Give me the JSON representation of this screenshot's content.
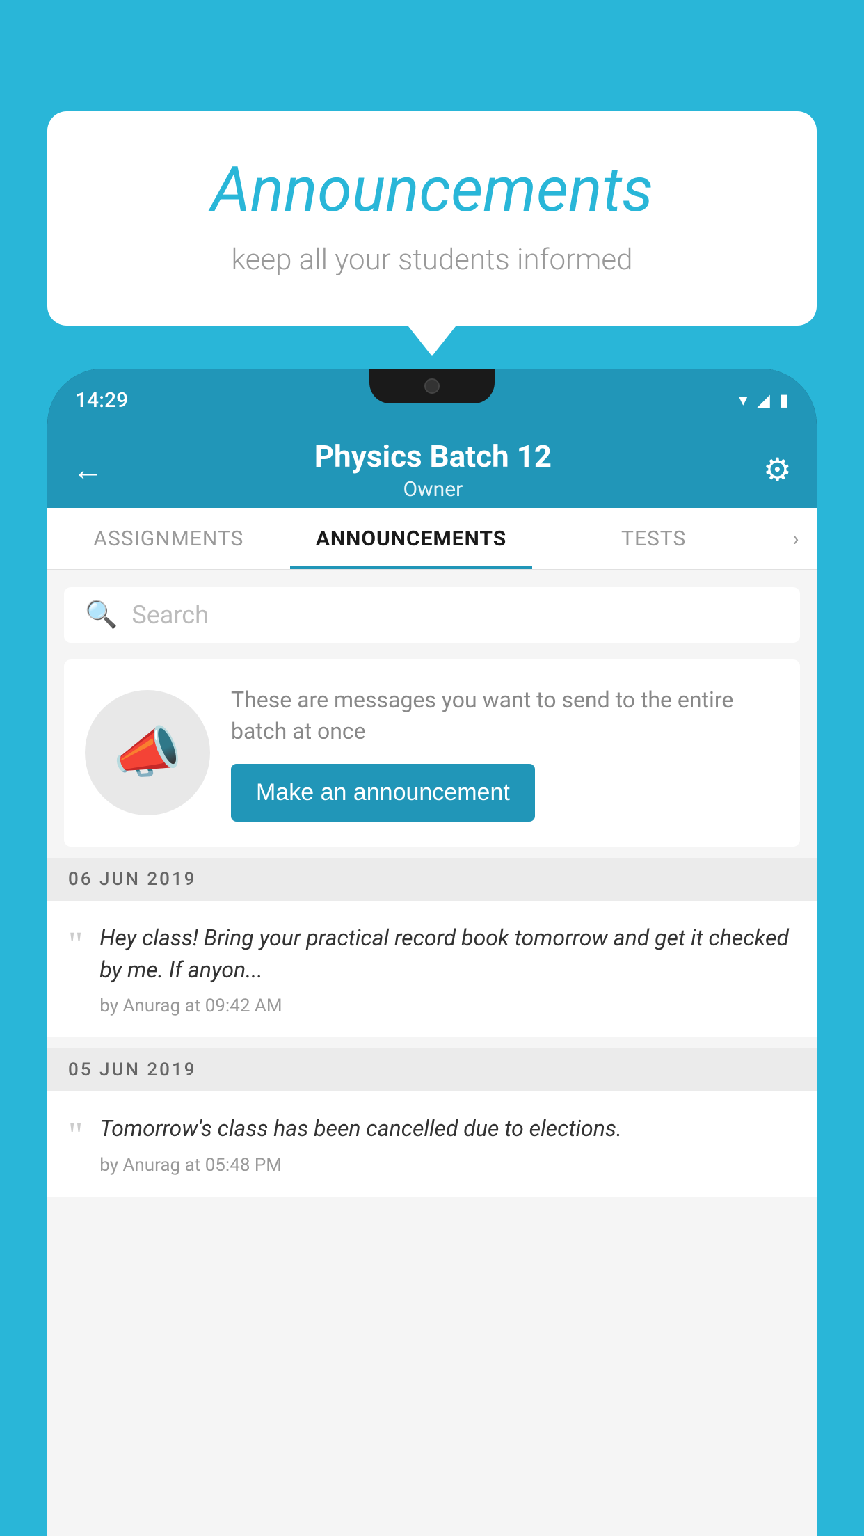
{
  "page": {
    "background_color": "#29b6d8"
  },
  "speech_bubble": {
    "title": "Announcements",
    "subtitle": "keep all your students informed"
  },
  "phone": {
    "status_bar": {
      "time": "14:29",
      "wifi_icon": "▾",
      "signal_icon": "▲",
      "battery_icon": "▮"
    },
    "header": {
      "back_label": "←",
      "title": "Physics Batch 12",
      "subtitle": "Owner",
      "settings_icon": "⚙"
    },
    "tabs": [
      {
        "label": "ASSIGNMENTS",
        "active": false
      },
      {
        "label": "ANNOUNCEMENTS",
        "active": true
      },
      {
        "label": "TESTS",
        "active": false
      }
    ],
    "search": {
      "placeholder": "Search"
    },
    "placeholder_card": {
      "description": "These are messages you want to send to the entire batch at once",
      "button_label": "Make an announcement"
    },
    "announcements": [
      {
        "date": "06  JUN  2019",
        "text": "Hey class! Bring your practical record book tomorrow and get it checked by me. If anyon...",
        "meta": "by Anurag at 09:42 AM"
      },
      {
        "date": "05  JUN  2019",
        "text": "Tomorrow's class has been cancelled due to elections.",
        "meta": "by Anurag at 05:48 PM"
      }
    ]
  }
}
